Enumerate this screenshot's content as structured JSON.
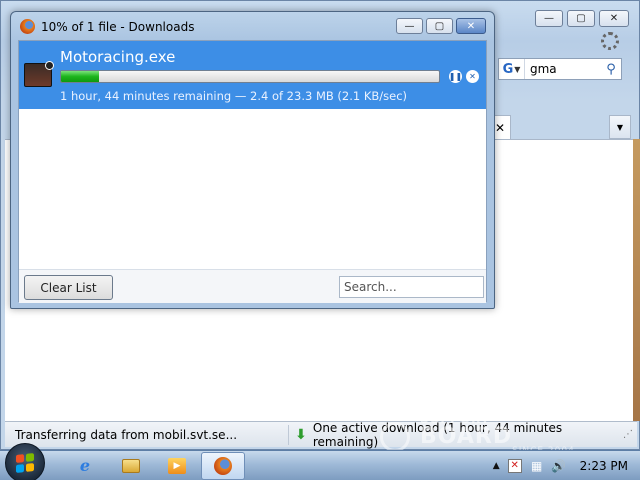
{
  "browser": {
    "window_controls": {
      "minimize": "—",
      "maximize": "▢",
      "close": "✕"
    },
    "search": {
      "engine_icon": "G",
      "value": "gma",
      "go_icon": "⚲"
    },
    "tab_close_icon": "✕",
    "tab_list_icon": "▼",
    "status_text": "Transferring data from mobil.svt.se...",
    "status_download": "One active download (1 hour, 44 minutes remaining)"
  },
  "downloads_window": {
    "title": "10% of 1 file - Downloads",
    "window_controls": {
      "minimize": "—",
      "maximize": "▢",
      "close": "✕"
    },
    "item": {
      "filename": "Motoracing.exe",
      "progress_fraction": 0.1,
      "status": "1 hour, 44 minutes remaining — 2.4 of 23.3 MB (2.1 KB/sec)",
      "pause_icon": "❚❚",
      "cancel_icon": "✕"
    },
    "clear_list_label": "Clear List",
    "search_placeholder": "Search..."
  },
  "taskbar": {
    "ie_icon": "e",
    "media_icon": "▶",
    "tray_arrow": "▲",
    "tray_flag": "✕",
    "tray_network": "▦",
    "tray_volume": "🔊",
    "clock": "2:23 PM",
    "flag_colors": [
      "#f25022",
      "#7fba00",
      "#00a4ef",
      "#ffb900"
    ]
  },
  "watermark": {
    "top": "SUPPORT",
    "main": "BOARD",
    "sub": "SINCE 2004"
  }
}
